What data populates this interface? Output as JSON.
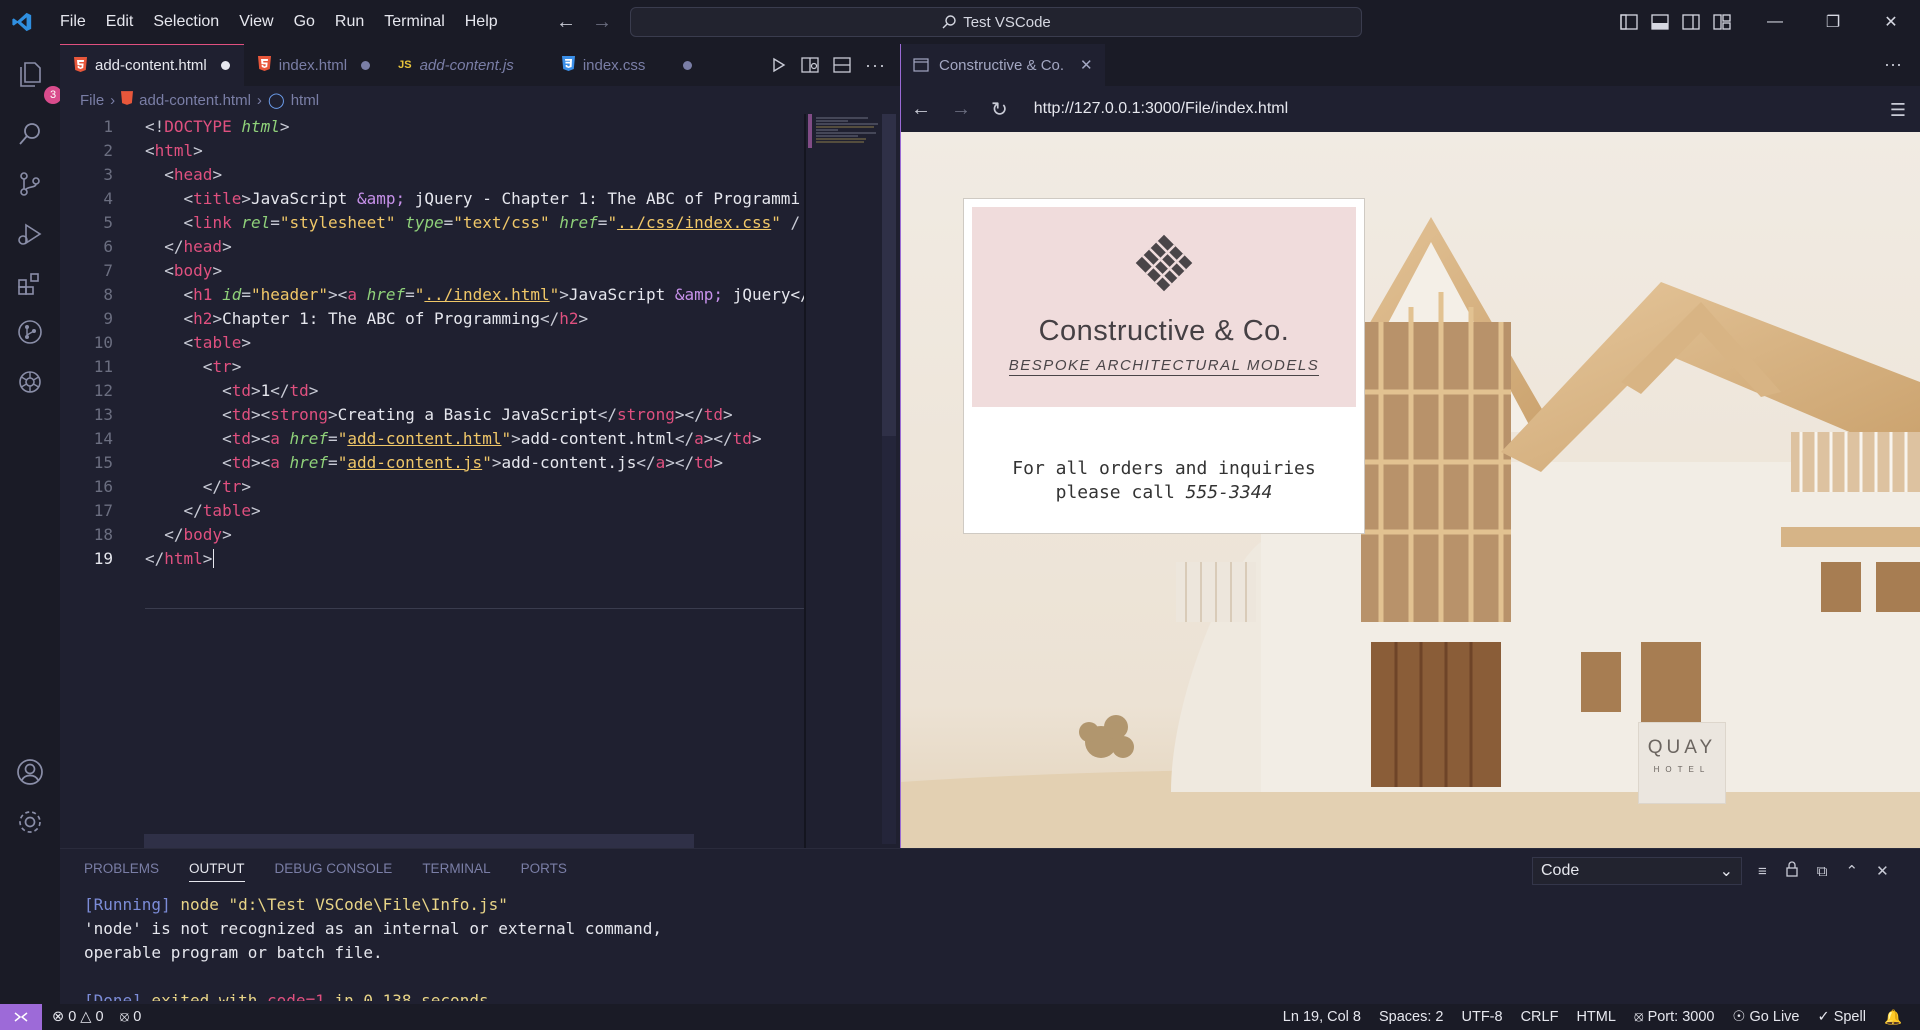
{
  "menu": [
    "File",
    "Edit",
    "Selection",
    "View",
    "Go",
    "Run",
    "Terminal",
    "Help"
  ],
  "search": {
    "label": "Test VSCode"
  },
  "activity": {
    "explorer_badge": "3"
  },
  "tabs": [
    {
      "label": "add-content.html",
      "type": "html",
      "icon": "html5-icon",
      "active": true,
      "modified": true
    },
    {
      "label": "index.html",
      "type": "html",
      "icon": "html5-icon",
      "active": false,
      "modified": true
    },
    {
      "label": "add-content.js",
      "type": "js",
      "icon_text": "JS",
      "active": false,
      "modified": false,
      "italic": true
    },
    {
      "label": "index.css",
      "type": "css",
      "icon": "css3-icon",
      "active": false,
      "modified": true
    }
  ],
  "breadcrumb": {
    "folder": "File",
    "file": "add-content.html",
    "symbol": "html"
  },
  "code": {
    "line_numbers": [
      "1",
      "2",
      "3",
      "4",
      "5",
      "6",
      "7",
      "8",
      "9",
      "10",
      "11",
      "12",
      "13",
      "14",
      "15",
      "16",
      "17",
      "18",
      "19"
    ],
    "current_line": "19"
  },
  "preview": {
    "tab_title": "Constructive & Co.",
    "url": "http://127.0.0.1:3000/File/index.html",
    "brand": "Constructive & Co.",
    "tagline": "BESPOKE ARCHITECTURAL MODELS",
    "info_line1": "For all orders and inquiries",
    "info_line2_prefix": "please call ",
    "phone": "555-3344",
    "sign_title": "QUAY",
    "sign_sub": "HOTEL"
  },
  "panel": {
    "tabs": [
      "PROBLEMS",
      "OUTPUT",
      "DEBUG CONSOLE",
      "TERMINAL",
      "PORTS"
    ],
    "active_tab": "OUTPUT",
    "output_channel": "Code",
    "out1_tag": "[Running]",
    "out1_rest": " node \"d:\\Test VSCode\\File\\Info.js\"",
    "out2": "'node' is not recognized as an internal or external command,",
    "out3": "operable program or batch file.",
    "out4_tag": "[Done]",
    "out4_a": " exited with ",
    "out4_code": "code=1",
    "out4_b": " in 0.138 seconds"
  },
  "status": {
    "errors": "0",
    "warnings": "0",
    "ports_count": "0",
    "position": "Ln 19, Col 8",
    "spaces": "Spaces: 2",
    "encoding": "UTF-8",
    "eol": "CRLF",
    "language": "HTML",
    "port": "Port: 3000",
    "golive": "Go Live",
    "spell": "Spell"
  },
  "colors": {
    "accent": "#e0507f",
    "remote": "#9d6ad8",
    "background": "#1f2030"
  }
}
